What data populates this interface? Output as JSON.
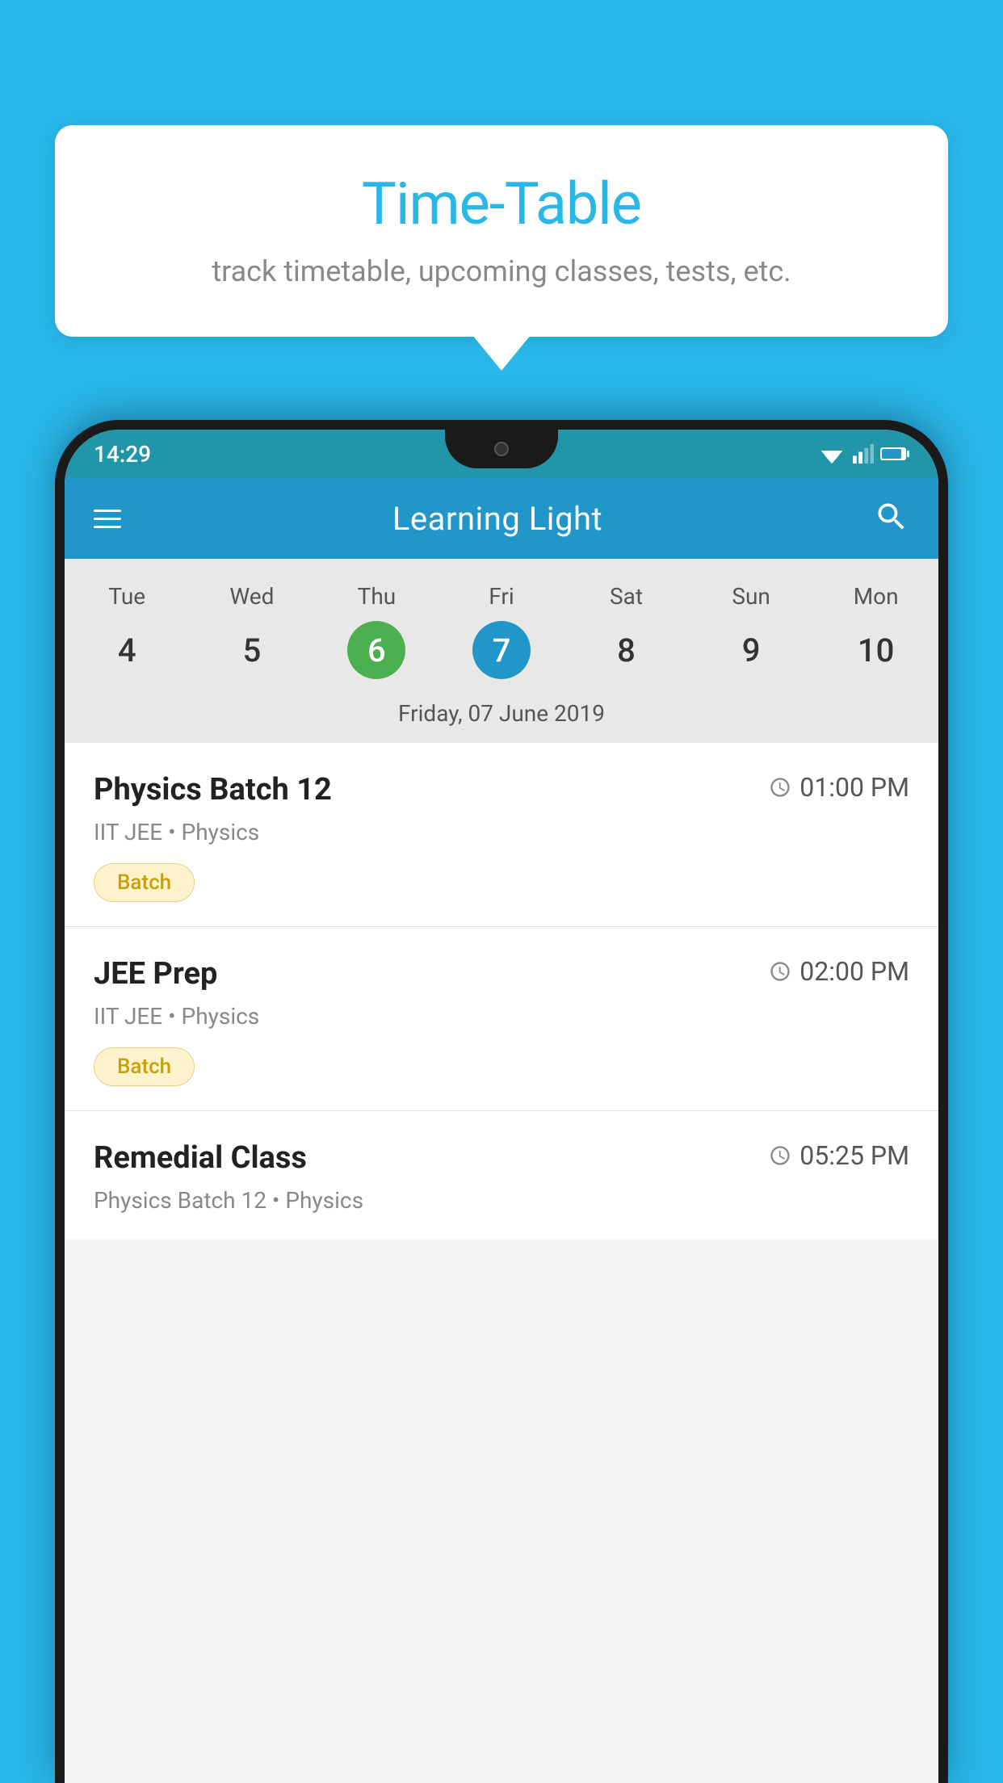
{
  "background_color": "#29B6E8",
  "bubble": {
    "title": "Time-Table",
    "subtitle": "track timetable, upcoming classes, tests, etc."
  },
  "status_bar": {
    "time": "14:29"
  },
  "app_bar": {
    "title": "Learning Light"
  },
  "calendar": {
    "days": [
      {
        "name": "Tue",
        "num": "4",
        "state": "normal"
      },
      {
        "name": "Wed",
        "num": "5",
        "state": "normal"
      },
      {
        "name": "Thu",
        "num": "6",
        "state": "today"
      },
      {
        "name": "Fri",
        "num": "7",
        "state": "selected"
      },
      {
        "name": "Sat",
        "num": "8",
        "state": "normal"
      },
      {
        "name": "Sun",
        "num": "9",
        "state": "normal"
      },
      {
        "name": "Mon",
        "num": "10",
        "state": "normal"
      }
    ],
    "date_label": "Friday, 07 June 2019"
  },
  "events": [
    {
      "name": "Physics Batch 12",
      "time": "01:00 PM",
      "meta": "IIT JEE • Physics",
      "badge": "Batch"
    },
    {
      "name": "JEE Prep",
      "time": "02:00 PM",
      "meta": "IIT JEE • Physics",
      "badge": "Batch"
    },
    {
      "name": "Remedial Class",
      "time": "05:25 PM",
      "meta": "Physics Batch 12 • Physics",
      "badge": null
    }
  ],
  "icons": {
    "hamburger": "☰",
    "search": "🔍",
    "clock": "🕐"
  }
}
